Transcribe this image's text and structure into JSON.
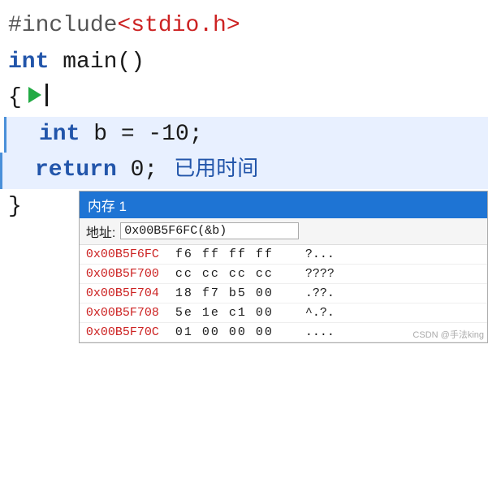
{
  "code": {
    "line1": {
      "prefix": "#include",
      "bracket_open": "<",
      "filename": "stdio.h",
      "bracket_close": ">"
    },
    "line2": {
      "kw": "int",
      "rest": " main()"
    },
    "line3": {
      "text": "{"
    },
    "line4": {
      "kw": "int",
      "rest": " b = -10;"
    },
    "line5": {
      "kw": "return",
      "rest": " 0;",
      "elapsed": "已用时间"
    },
    "line6": {
      "text": "}"
    }
  },
  "memory_window": {
    "title": "内存 1",
    "address_label": "地址:",
    "address_value": "0x00B5F6FC(&b)",
    "rows": [
      {
        "addr": "0x00B5F6FC",
        "hex": "f6 ff ff ff",
        "ascii": "?..."
      },
      {
        "addr": "0x00B5F700",
        "hex": "cc cc cc cc",
        "ascii": "????"
      },
      {
        "addr": "0x00B5F704",
        "hex": "18 f7 b5 00",
        "ascii": ".??."
      },
      {
        "addr": "0x00B5F708",
        "hex": "5e 1e c1 00",
        "ascii": "^.?."
      },
      {
        "addr": "0x00B5F70C",
        "hex": "01 00 00 00",
        "ascii": "...."
      }
    ]
  },
  "watermark": "CSDN @手法king"
}
